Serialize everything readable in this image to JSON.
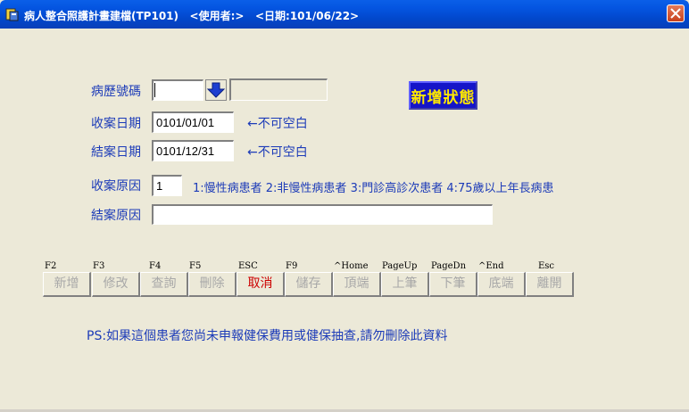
{
  "window": {
    "title": "病人整合照護計畫建檔(TP101)   <使用者:>   <日期:101/06/22>"
  },
  "form": {
    "record_no": {
      "label": "病歷號碼",
      "value": "",
      "name_value": ""
    },
    "intake_date": {
      "label": "收案日期",
      "value": "0101/01/01",
      "note": "←不可空白"
    },
    "close_date": {
      "label": "結案日期",
      "value": "0101/12/31",
      "note": "←不可空白"
    },
    "intake_reason": {
      "label": "收案原因",
      "value": "1",
      "hint": "1:慢性病患者 2:非慢性病患者 3:門診高診次患者 4:75歲以上年長病患"
    },
    "close_reason": {
      "label": "結案原因",
      "value": ""
    }
  },
  "status_badge": "新增狀態",
  "toolbar": {
    "buttons": [
      {
        "key": "F2",
        "label": "新增",
        "enabled": false
      },
      {
        "key": "F3",
        "label": "修改",
        "enabled": false
      },
      {
        "key": "F4",
        "label": "查詢",
        "enabled": false
      },
      {
        "key": "F5",
        "label": "刪除",
        "enabled": false
      },
      {
        "key": "ESC",
        "label": "取消",
        "enabled": true
      },
      {
        "key": "F9",
        "label": "儲存",
        "enabled": false
      },
      {
        "key": "^Home",
        "label": "頂端",
        "enabled": false
      },
      {
        "key": "PageUp",
        "label": "上筆",
        "enabled": false
      },
      {
        "key": "PageDn",
        "label": "下筆",
        "enabled": false
      },
      {
        "key": "^End",
        "label": "底端",
        "enabled": false
      },
      {
        "key": "Esc",
        "label": "離開",
        "enabled": false
      }
    ]
  },
  "ps_note": "PS:如果這個患者您尚未申報健保費用或健保抽查,請勿刪除此資料",
  "colors": {
    "label": "#1C3BB8",
    "badge_bg": "#1515C8",
    "badge_text": "#FFE800",
    "active_button": "#CC0000"
  }
}
